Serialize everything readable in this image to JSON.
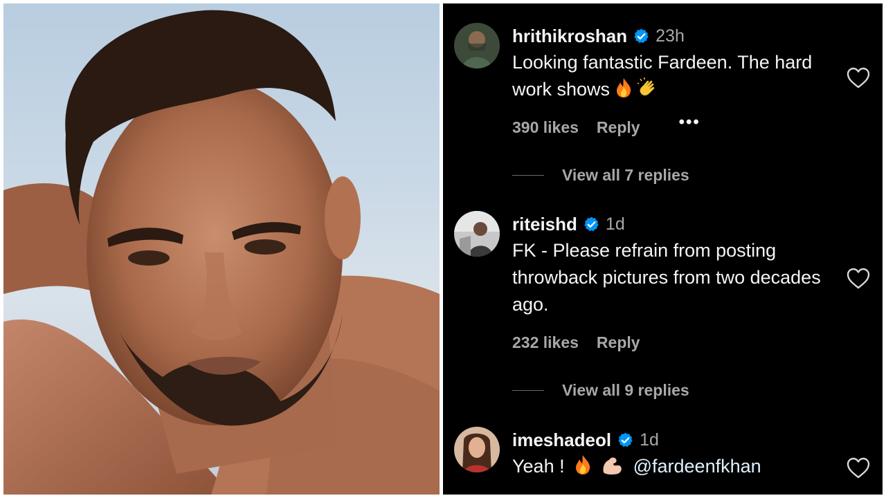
{
  "comments": [
    {
      "username": "hrithikroshan",
      "verified": true,
      "timestamp": "23h",
      "text": "Looking fantastic Fardeen. The hard work shows",
      "emojis": [
        "fire",
        "clapping-hands"
      ],
      "likes": "390 likes",
      "reply_label": "Reply",
      "view_replies": "View all 7 replies"
    },
    {
      "username": "riteishd",
      "verified": true,
      "timestamp": "1d",
      "text": "FK - Please refrain from posting throwback pictures from two decades ago.",
      "likes": "232 likes",
      "reply_label": "Reply",
      "view_replies": "View all 9 replies"
    },
    {
      "username": "imeshadeol",
      "verified": true,
      "timestamp": "1d",
      "text_prefix": "Yeah !",
      "emojis": [
        "fire",
        "flexed-biceps"
      ],
      "mention": "@fardeenfkhan"
    }
  ],
  "colors": {
    "panel_background": "#000000",
    "primary_text": "#f5f5f5",
    "secondary_text": "#a8a8a8",
    "verified_blue": "#0095f6"
  },
  "icons": {
    "verified": "verified-badge-icon",
    "like": "heart-outline-icon",
    "more": "more-options-icon"
  }
}
